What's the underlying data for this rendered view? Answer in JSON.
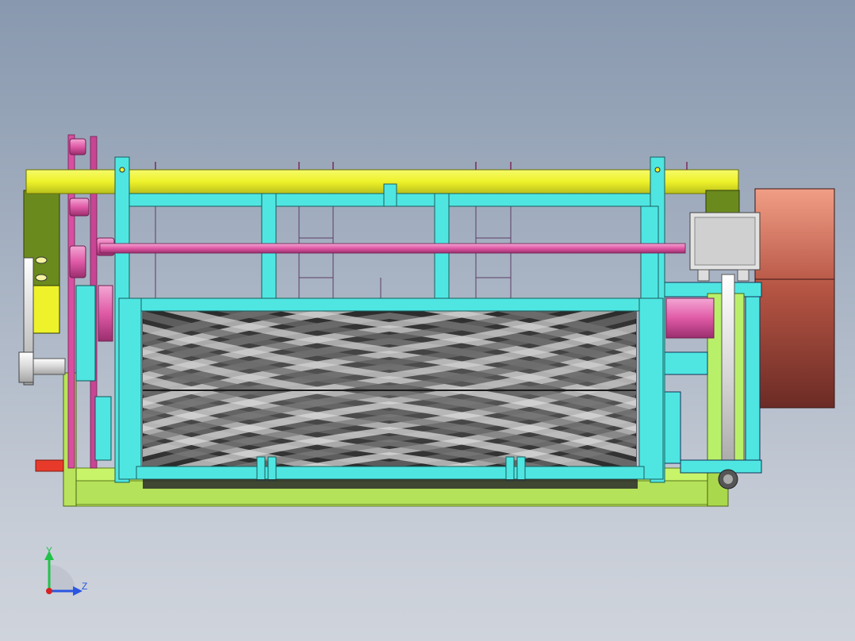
{
  "viewport": {
    "background_top": "#8898ae",
    "background_bottom": "#cfd4dc"
  },
  "model": {
    "colors": {
      "top_beam": "#eef22a",
      "frame": "#4fe6e2",
      "shaft_pink": "#e05aa6",
      "base_green": "#c8f46a",
      "dark_green": "#6b8a1e",
      "roller": "#3a3a3a",
      "box": "#e2e2e2",
      "motor_top": "#e37a5e",
      "motor_bottom": "#5a2626"
    }
  },
  "triad": {
    "y_label": "Y",
    "z_label": "Z",
    "y_color": "#22c24a",
    "z_color": "#2a56e0",
    "x_color": "#d62222"
  }
}
